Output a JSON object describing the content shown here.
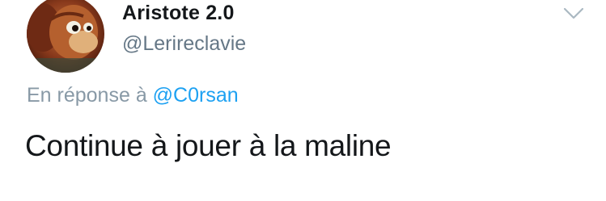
{
  "tweet": {
    "display_name": "Aristote 2.0",
    "handle": "@Lerireclavie",
    "reply_prefix": "En réponse à",
    "reply_mention": "@C0rsan",
    "text": "Continue à jouer à la maline"
  },
  "icons": {
    "avatar": "monkey-puppet-avatar",
    "menu": "chevron-down-icon"
  },
  "colors": {
    "name": "#14171a",
    "handle": "#657786",
    "reply_text": "#8899a6",
    "mention": "#1da1f2",
    "chevron": "#aab8c2"
  }
}
